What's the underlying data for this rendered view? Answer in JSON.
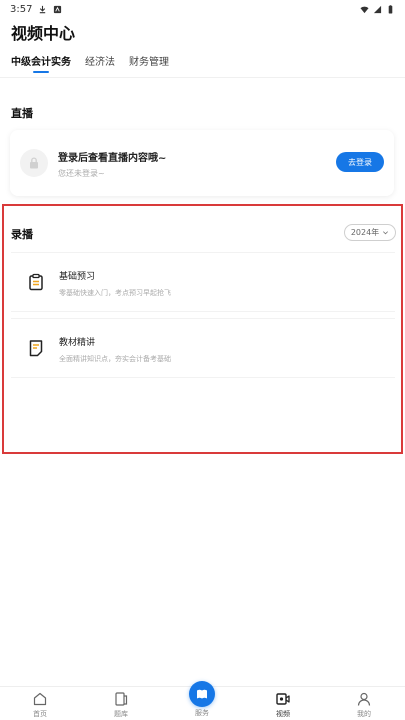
{
  "status_bar": {
    "time": "3:57"
  },
  "header": {
    "title": "视频中心"
  },
  "tabs": [
    {
      "label": "中级会计实务",
      "active": true
    },
    {
      "label": "经济法",
      "active": false
    },
    {
      "label": "财务管理",
      "active": false
    }
  ],
  "live": {
    "section_title": "直播",
    "main_text": "登录后查看直播内容哦~",
    "sub_text": "您还未登录~",
    "login_button": "去登录"
  },
  "recorded": {
    "section_title": "录播",
    "year": "2024年",
    "items": [
      {
        "title": "基础预习",
        "desc": "零基础快速入门，考点预习早起抢飞",
        "icon": "clipboard-icon"
      },
      {
        "title": "教材精讲",
        "desc": "全面精讲知识点，夯实会计备考基础",
        "icon": "document-icon"
      }
    ]
  },
  "bottom_nav": {
    "items": [
      {
        "label": "首页",
        "icon": "home-icon"
      },
      {
        "label": "题库",
        "icon": "question-bank-icon"
      },
      {
        "label": "服务",
        "icon": "book-icon"
      },
      {
        "label": "视频",
        "icon": "video-icon"
      },
      {
        "label": "我的",
        "icon": "profile-icon"
      }
    ]
  },
  "colors": {
    "accent": "#1677e6",
    "highlight_border": "#d93a3a"
  }
}
